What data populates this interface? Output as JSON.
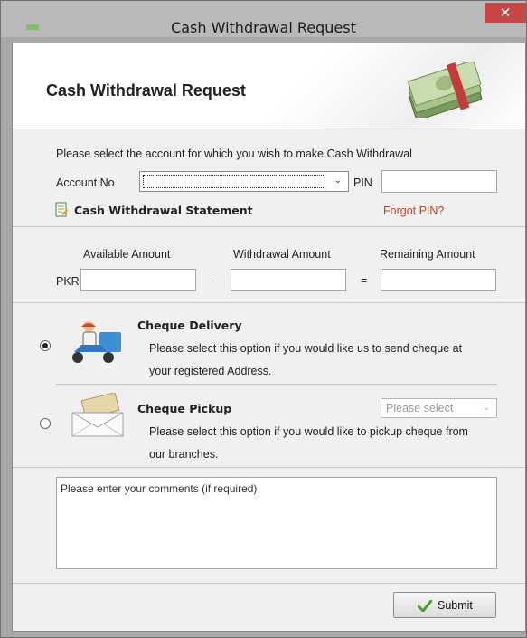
{
  "window": {
    "title": "Cash Withdrawal Request",
    "close_glyph": "✕"
  },
  "header": {
    "title": "Cash Withdrawal Request",
    "icon": "money-stack-icon"
  },
  "account": {
    "instruction": "Please select the account for which you wish to make Cash Withdrawal",
    "account_no_label": "Account No",
    "account_no_value": "",
    "pin_label": "PIN",
    "pin_value": "",
    "statement_label": "Cash Withdrawal Statement",
    "forgot_pin": "Forgot PIN?"
  },
  "amounts": {
    "available_label": "Available Amount",
    "withdrawal_label": "Withdrawal Amount",
    "remaining_label": "Remaining Amount",
    "currency": "PKR",
    "minus": "-",
    "equals": "=",
    "available_value": "",
    "withdrawal_value": "",
    "remaining_value": ""
  },
  "delivery": {
    "title": "Cheque Delivery",
    "line1": "Please select this option if you would like us to send cheque at",
    "line2": "your registered Address.",
    "selected": true,
    "icon": "delivery-scooter-icon"
  },
  "pickup": {
    "title": "Cheque Pickup",
    "line1": "Please select this option if you would like to pickup cheque from",
    "line2": "our branches.",
    "selected": false,
    "branch_placeholder": "Please select",
    "icon": "envelope-cheque-icon"
  },
  "comments": {
    "placeholder": "Please enter your comments (if required)"
  },
  "footer": {
    "submit_label": "Submit"
  }
}
